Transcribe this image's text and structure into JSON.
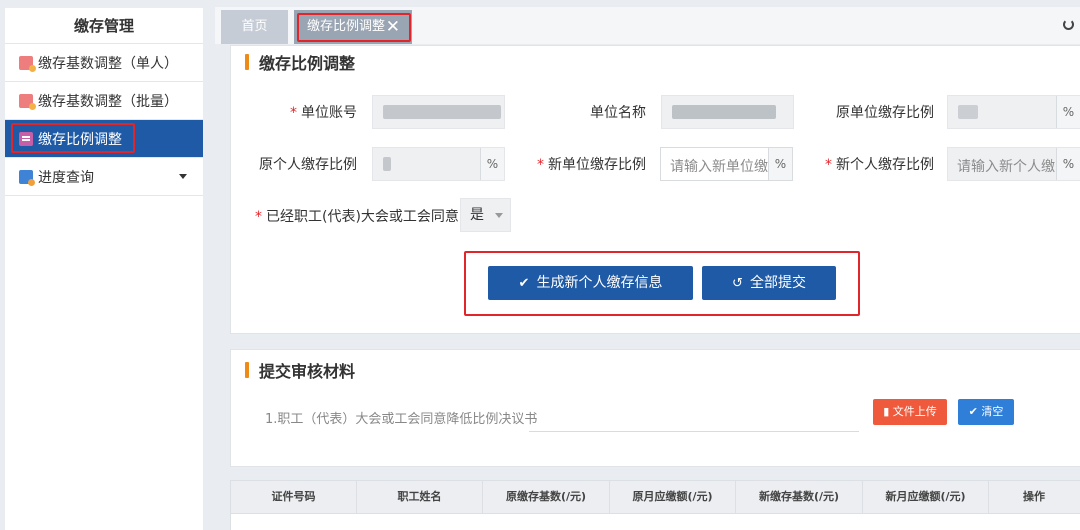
{
  "sidebar": {
    "title": "缴存管理",
    "items": [
      {
        "label": "缴存基数调整（单人）",
        "icon": "person-adjust-icon"
      },
      {
        "label": "缴存基数调整（批量）",
        "icon": "person-adjust-icon"
      },
      {
        "label": "缴存比例调整",
        "icon": "sheet-icon",
        "active": true
      },
      {
        "label": "进度查询",
        "icon": "house-icon"
      }
    ]
  },
  "tabs": {
    "home": "首页",
    "active": "缴存比例调整",
    "close": "✕"
  },
  "section1": {
    "title": "缴存比例调整",
    "fields": {
      "unit_account_label": "单位账号",
      "unit_name_label": "单位名称",
      "orig_unit_ratio_label": "原单位缴存比例",
      "orig_person_ratio_label": "原个人缴存比例",
      "new_unit_ratio_label": "新单位缴存比例",
      "new_unit_ratio_placeholder": "请输入新单位缴",
      "new_person_ratio_label": "新个人缴存比例",
      "new_person_ratio_placeholder": "请输入新个人缴",
      "percent": "%",
      "agree_label": "已经职工(代表)大会或工会同意:",
      "agree_value": "是"
    },
    "buttons": {
      "generate": "生成新个人缴存信息",
      "submit_all": "全部提交"
    }
  },
  "section2": {
    "title": "提交审核材料",
    "upload_item": "1.职工（代表）大会或工会同意降低比例决议书",
    "upload_button": "文件上传",
    "clear_button": "清空"
  },
  "table": {
    "headers": [
      "证件号码",
      "职工姓名",
      "原缴存基数(/元)",
      "原月应缴额(/元)",
      "新缴存基数(/元)",
      "新月应缴额(/元)",
      "操作"
    ]
  },
  "colors": {
    "primary": "#1f5aa6",
    "accent_orange": "#f08a16",
    "highlight_red": "#e0262b"
  }
}
